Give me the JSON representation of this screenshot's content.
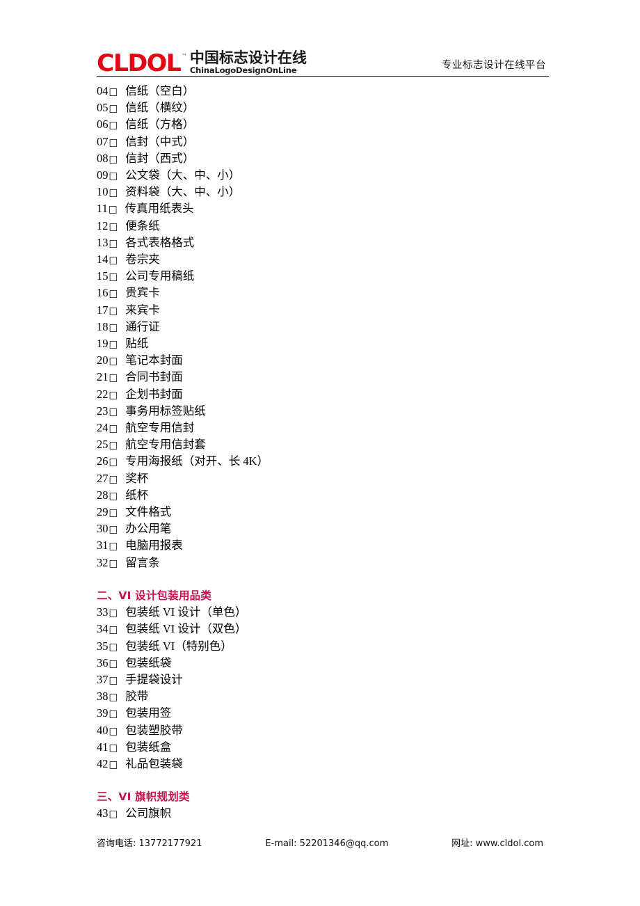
{
  "header": {
    "logo_word": "CLDOL",
    "logo_tm": "™",
    "logo_cn": "中国标志设计在线",
    "logo_en": "ChinaLogoDesignOnLine",
    "right_title": "专业标志设计在线平台"
  },
  "list": [
    {
      "num": "04",
      "box": "□",
      "label": "信纸（空白）"
    },
    {
      "num": "05",
      "box": "□",
      "label": "信纸（横纹）"
    },
    {
      "num": "06",
      "box": "□",
      "label": "信纸（方格）"
    },
    {
      "num": "07",
      "box": "□",
      "label": "信封（中式）"
    },
    {
      "num": "08",
      "box": "□",
      "label": "信封（西式）"
    },
    {
      "num": "09",
      "box": "□",
      "label": "公文袋（大、中、小）"
    },
    {
      "num": "10",
      "box": "□",
      "label": "资料袋（大、中、小）"
    },
    {
      "num": "11",
      "box": "□",
      "label": "传真用纸表头"
    },
    {
      "num": "12",
      "box": "□",
      "label": "便条纸"
    },
    {
      "num": "13",
      "box": "□",
      "label": "各式表格格式"
    },
    {
      "num": "14",
      "box": "□",
      "label": "卷宗夹"
    },
    {
      "num": "15",
      "box": "□",
      "label": "公司专用稿纸"
    },
    {
      "num": "16",
      "box": "□",
      "label": "贵宾卡"
    },
    {
      "num": "17",
      "box": "□",
      "label": "来宾卡"
    },
    {
      "num": "18",
      "box": "□",
      "label": "通行证"
    },
    {
      "num": "19",
      "box": "□",
      "label": "贴纸"
    },
    {
      "num": "20",
      "box": "□",
      "label": "笔记本封面"
    },
    {
      "num": "21",
      "box": "□",
      "label": "合同书封面"
    },
    {
      "num": "22",
      "box": "□",
      "label": "企划书封面"
    },
    {
      "num": "23",
      "box": "□",
      "label": "事务用标签贴纸"
    },
    {
      "num": "24",
      "box": "□",
      "label": "航空专用信封"
    },
    {
      "num": "25",
      "box": "□",
      "label": "航空专用信封套"
    },
    {
      "num": "26",
      "box": "□",
      "label": "专用海报纸（对开、长 4K）"
    },
    {
      "num": "27",
      "box": "□",
      "label": "奖杯"
    },
    {
      "num": "28",
      "box": "□",
      "label": "纸杯"
    },
    {
      "num": "29",
      "box": "□",
      "label": "文件格式"
    },
    {
      "num": "30",
      "box": "□",
      "label": "办公用笔"
    },
    {
      "num": "31",
      "box": "□",
      "label": "电脑用报表"
    },
    {
      "num": "32",
      "box": "□",
      "label": "留言条"
    }
  ],
  "section_two": {
    "heading": "二、VI 设计包装用品类",
    "items": [
      {
        "num": "33",
        "box": "□",
        "label": "包装纸 VI 设计（单色）"
      },
      {
        "num": "34",
        "box": "□",
        "label": "包装纸 VI 设计（双色）"
      },
      {
        "num": "35",
        "box": "□",
        "label": "包装纸 VI（特别色）"
      },
      {
        "num": "36",
        "box": "□",
        "label": "包装纸袋"
      },
      {
        "num": "37",
        "box": "□",
        "label": "手提袋设计"
      },
      {
        "num": "38",
        "box": "□",
        "label": "胶带"
      },
      {
        "num": "39",
        "box": "□",
        "label": "包装用签"
      },
      {
        "num": "40",
        "box": "□",
        "label": "包装塑胶带"
      },
      {
        "num": "41",
        "box": "□",
        "label": "包装纸盒"
      },
      {
        "num": "42",
        "box": "□",
        "label": "礼品包装袋"
      }
    ]
  },
  "section_three": {
    "heading": "三、VI 旗帜规划类",
    "items": [
      {
        "num": "43",
        "box": "□",
        "label": "公司旗帜"
      }
    ]
  },
  "footer": {
    "phone": "咨询电话: 13772177921",
    "email": "E-mail: 52201346@qq.com",
    "website": "网址: www.cldol.com"
  },
  "colors": {
    "logo_red": "#E30613",
    "heading_red": "#C9104F",
    "text": "#000000"
  }
}
